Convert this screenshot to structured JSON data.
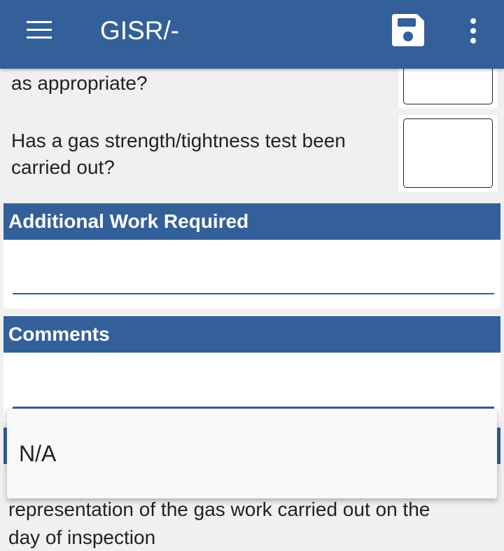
{
  "appbar": {
    "title": "GISR/-",
    "menu_icon": "hamburger-menu-icon",
    "save_icon": "floppy-disk-save-icon",
    "more_icon": "vertical-ellipsis-icon"
  },
  "questions": [
    {
      "text": "as appropriate?"
    },
    {
      "text_line1": "Has a gas strength/tightness test been",
      "text_line2": "carried out?"
    }
  ],
  "sections": {
    "additional_work": {
      "header": "Additional Work Required",
      "value": ""
    },
    "comments": {
      "header": "Comments",
      "value": ""
    }
  },
  "dropdown": {
    "options": [
      "N/A"
    ]
  },
  "footer_text": {
    "line1": "representation of the gas work carried out on the",
    "line2": "day of inspection"
  },
  "colors": {
    "primary": "#34609a",
    "background": "#f0f0f0",
    "text": "#222222"
  }
}
